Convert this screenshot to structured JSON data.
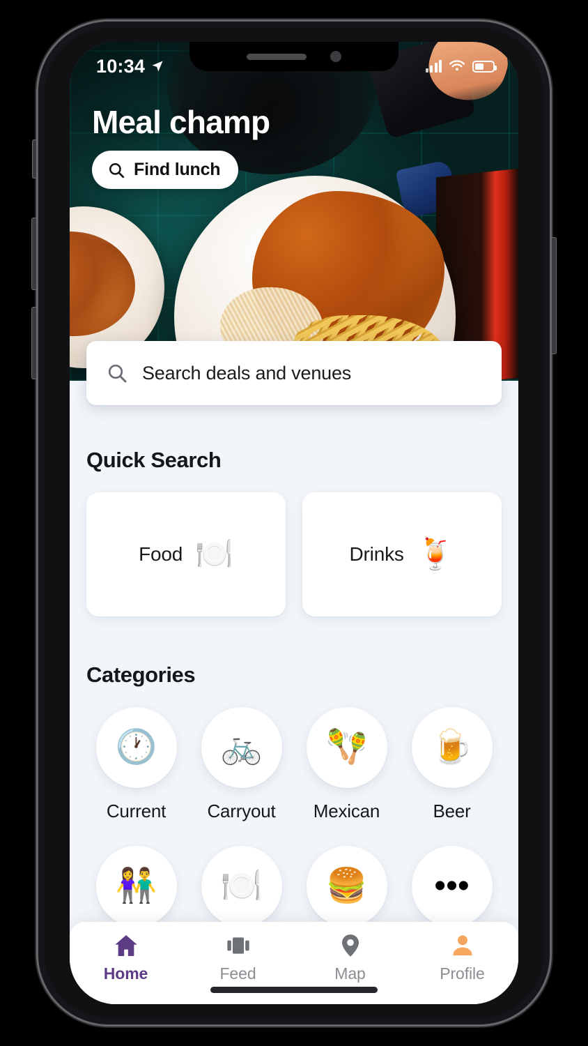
{
  "status_bar": {
    "time": "10:34",
    "location_icon": "location-arrow-icon",
    "signal_icon": "cellular-signal-icon",
    "wifi_icon": "wifi-icon",
    "battery_icon": "battery-icon"
  },
  "hero": {
    "app_title": "Meal champ",
    "find_button": {
      "label": "Find lunch",
      "icon": "search-icon"
    },
    "photo_description": "fried chicken with coleslaw and fries on a white plate"
  },
  "search": {
    "placeholder": "Search deals and venues",
    "value": "",
    "icon": "search-icon"
  },
  "quick_search": {
    "title": "Quick Search",
    "cards": [
      {
        "label": "Food",
        "emoji": "🍽️",
        "icon_name": "plate-cutlery-icon"
      },
      {
        "label": "Drinks",
        "emoji": "🍹",
        "icon_name": "tropical-drink-icon"
      }
    ]
  },
  "categories": {
    "title": "Categories",
    "items": [
      {
        "label": "Current",
        "emoji": "🕐",
        "icon_name": "clock-icon"
      },
      {
        "label": "Carryout",
        "emoji": "🚲",
        "icon_name": "bicycle-icon"
      },
      {
        "label": "Mexican",
        "emoji": "🪇",
        "icon_name": "maracas-icon"
      },
      {
        "label": "Beer",
        "emoji": "🍺",
        "icon_name": "beer-mug-icon"
      },
      {
        "label": "",
        "emoji": "👫",
        "icon_name": "couple-icon"
      },
      {
        "label": "",
        "emoji": "🍽️",
        "icon_name": "plate-cutlery-icon"
      },
      {
        "label": "",
        "emoji": "🍔",
        "icon_name": "hamburger-icon"
      },
      {
        "label": "",
        "emoji": "•••",
        "icon_name": "more-dots-icon"
      }
    ]
  },
  "tabbar": {
    "items": [
      {
        "label": "Home",
        "icon_name": "home-icon",
        "active": true
      },
      {
        "label": "Feed",
        "icon_name": "feed-icon",
        "active": false
      },
      {
        "label": "Map",
        "icon_name": "map-pin-icon",
        "active": false
      },
      {
        "label": "Profile",
        "icon_name": "person-icon",
        "active": false
      }
    ]
  },
  "colors": {
    "accent_purple": "#5D3B85",
    "profile_orange": "#F5A55E",
    "inactive_gray": "#8A8D92",
    "page_background": "#F2F6FA",
    "card_white": "#FFFFFF"
  }
}
